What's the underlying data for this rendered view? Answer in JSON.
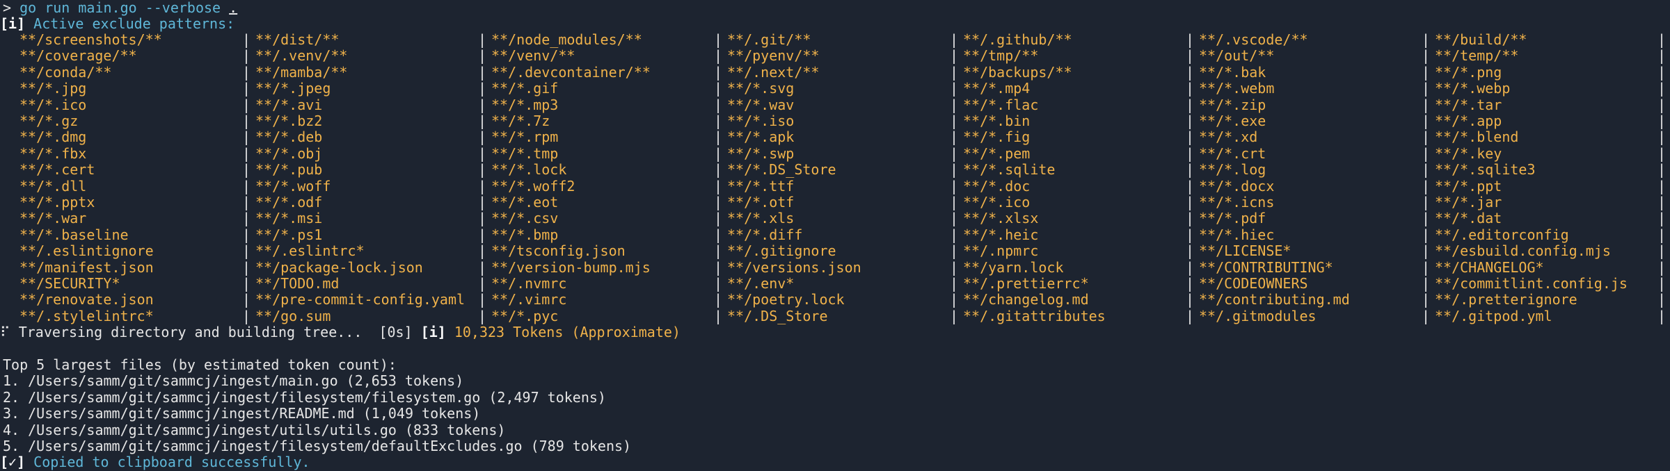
{
  "command": {
    "prompt": ">",
    "cmd": "go run main.go --verbose",
    "arg": "."
  },
  "patterns_header": {
    "tag": "[i]",
    "text": " Active exclude patterns:"
  },
  "separator": "|",
  "patterns": [
    [
      "**/screenshots/**",
      "**/dist/**",
      "**/node_modules/**",
      "**/.git/**",
      "**/.github/**",
      "**/.vscode/**",
      "**/build/**"
    ],
    [
      "**/coverage/**",
      "**/.venv/**",
      "**/venv/**",
      "**/pyenv/**",
      "**/tmp/**",
      "**/out/**",
      "**/temp/**"
    ],
    [
      "**/conda/**",
      "**/mamba/**",
      "**/.devcontainer/**",
      "**/.next/**",
      "**/backups/**",
      "**/*.bak",
      "**/*.png"
    ],
    [
      "**/*.jpg",
      "**/*.jpeg",
      "**/*.gif",
      "**/*.svg",
      "**/*.mp4",
      "**/*.webm",
      "**/*.webp"
    ],
    [
      "**/*.ico",
      "**/*.avi",
      "**/*.mp3",
      "**/*.wav",
      "**/*.flac",
      "**/*.zip",
      "**/*.tar"
    ],
    [
      "**/*.gz",
      "**/*.bz2",
      "**/*.7z",
      "**/*.iso",
      "**/*.bin",
      "**/*.exe",
      "**/*.app"
    ],
    [
      "**/*.dmg",
      "**/*.deb",
      "**/*.rpm",
      "**/*.apk",
      "**/*.fig",
      "**/*.xd",
      "**/*.blend"
    ],
    [
      "**/*.fbx",
      "**/*.obj",
      "**/*.tmp",
      "**/*.swp",
      "**/*.pem",
      "**/*.crt",
      "**/*.key"
    ],
    [
      "**/*.cert",
      "**/*.pub",
      "**/*.lock",
      "**/*.DS_Store",
      "**/*.sqlite",
      "**/*.log",
      "**/*.sqlite3"
    ],
    [
      "**/*.dll",
      "**/*.woff",
      "**/*.woff2",
      "**/*.ttf",
      "**/*.doc",
      "**/*.docx",
      "**/*.ppt"
    ],
    [
      "**/*.pptx",
      "**/*.odf",
      "**/*.eot",
      "**/*.otf",
      "**/*.ico",
      "**/*.icns",
      "**/*.jar"
    ],
    [
      "**/*.war",
      "**/*.msi",
      "**/*.csv",
      "**/*.xls",
      "**/*.xlsx",
      "**/*.pdf",
      "**/*.dat"
    ],
    [
      "**/*.baseline",
      "**/*.ps1",
      "**/*.bmp",
      "**/*.diff",
      "**/*.heic",
      "**/*.hiec",
      "**/.editorconfig"
    ],
    [
      "**/.eslintignore",
      "**/.eslintrc*",
      "**/tsconfig.json",
      "**/.gitignore",
      "**/.npmrc",
      "**/LICENSE*",
      "**/esbuild.config.mjs"
    ],
    [
      "**/manifest.json",
      "**/package-lock.json",
      "**/version-bump.mjs",
      "**/versions.json",
      "**/yarn.lock",
      "**/CONTRIBUTING*",
      "**/CHANGELOG*"
    ],
    [
      "**/SECURITY*",
      "**/TODO.md",
      "**/.nvmrc",
      "**/.env*",
      "**/.prettierrc*",
      "**/CODEOWNERS",
      "**/commitlint.config.js"
    ],
    [
      "**/renovate.json",
      "**/pre-commit-config.yaml",
      "**/.vimrc",
      "**/poetry.lock",
      "**/changelog.md",
      "**/contributing.md",
      "**/.pretterignore"
    ],
    [
      "**/.stylelintrc*",
      "**/go.sum",
      "**/*.pyc",
      "**/.DS_Store",
      "**/.gitattributes",
      "**/.gitmodules",
      "**/.gitpod.yml"
    ]
  ],
  "traverse": {
    "spinner": "⠏",
    "text": " Traversing directory and building tree...  [0s] ",
    "tag": "[i]",
    "tokens": " 10,323 Tokens (Approximate)"
  },
  "top_files": {
    "header": "Top 5 largest files (by estimated token count):",
    "items": [
      "1. /Users/samm/git/sammcj/ingest/main.go (2,653 tokens)",
      "2. /Users/samm/git/sammcj/ingest/filesystem/filesystem.go (2,497 tokens)",
      "3. /Users/samm/git/sammcj/ingest/README.md (1,049 tokens)",
      "4. /Users/samm/git/sammcj/ingest/utils/utils.go (833 tokens)",
      "5. /Users/samm/git/sammcj/ingest/filesystem/defaultExcludes.go (789 tokens)"
    ]
  },
  "clipboard": {
    "tag": "[✓]",
    "text": " Copied to clipboard successfully."
  }
}
